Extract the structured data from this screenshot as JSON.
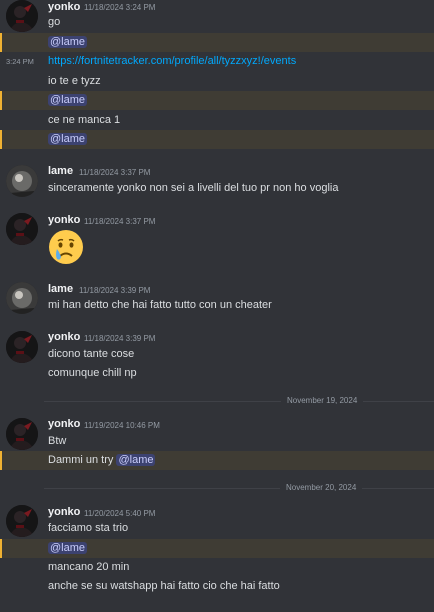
{
  "messages": {
    "g1": {
      "author": "yonko",
      "time": "11/18/2024 3:24 PM",
      "lines": [
        "go",
        "@lame",
        "https://fortnitetracker.com/profile/all/tyzzxyz!/events",
        "io te e tyzz",
        "@lame",
        "ce ne manca 1",
        "@lame"
      ],
      "side_time": "3:24 PM"
    },
    "g2": {
      "author": "lame",
      "time": "11/18/2024 3:37 PM",
      "lines": [
        "sinceramente yonko non sei a livelli del tuo pr non ho voglia"
      ]
    },
    "g3": {
      "author": "yonko",
      "time": "11/18/2024 3:37 PM",
      "emoji": "crying-face"
    },
    "g4": {
      "author": "lame",
      "time": "11/18/2024 3:39 PM",
      "lines": [
        "mi han detto che hai fatto tutto con un cheater"
      ]
    },
    "g5": {
      "author": "yonko",
      "time": "11/18/2024 3:39 PM",
      "lines": [
        "dicono tante cose",
        "comunque chill np"
      ]
    },
    "g6": {
      "author": "yonko",
      "time": "11/19/2024 10:46 PM",
      "lines": [
        "Btw",
        "Dammi un try"
      ],
      "mention": "@lame"
    },
    "g7": {
      "author": "yonko",
      "time": "11/20/2024 5:40 PM",
      "lines": [
        "facciamo sta trio",
        "@lame",
        "mancano 20 min",
        "anche se su watshapp hai fatto cio che hai fatto"
      ]
    }
  },
  "dividers": [
    "November 19, 2024",
    "November 20, 2024"
  ],
  "colors": {
    "background": "#313338",
    "mention_highlight": "#3f3c34",
    "mention_bar": "#f0b232",
    "link": "#00a8fc"
  }
}
